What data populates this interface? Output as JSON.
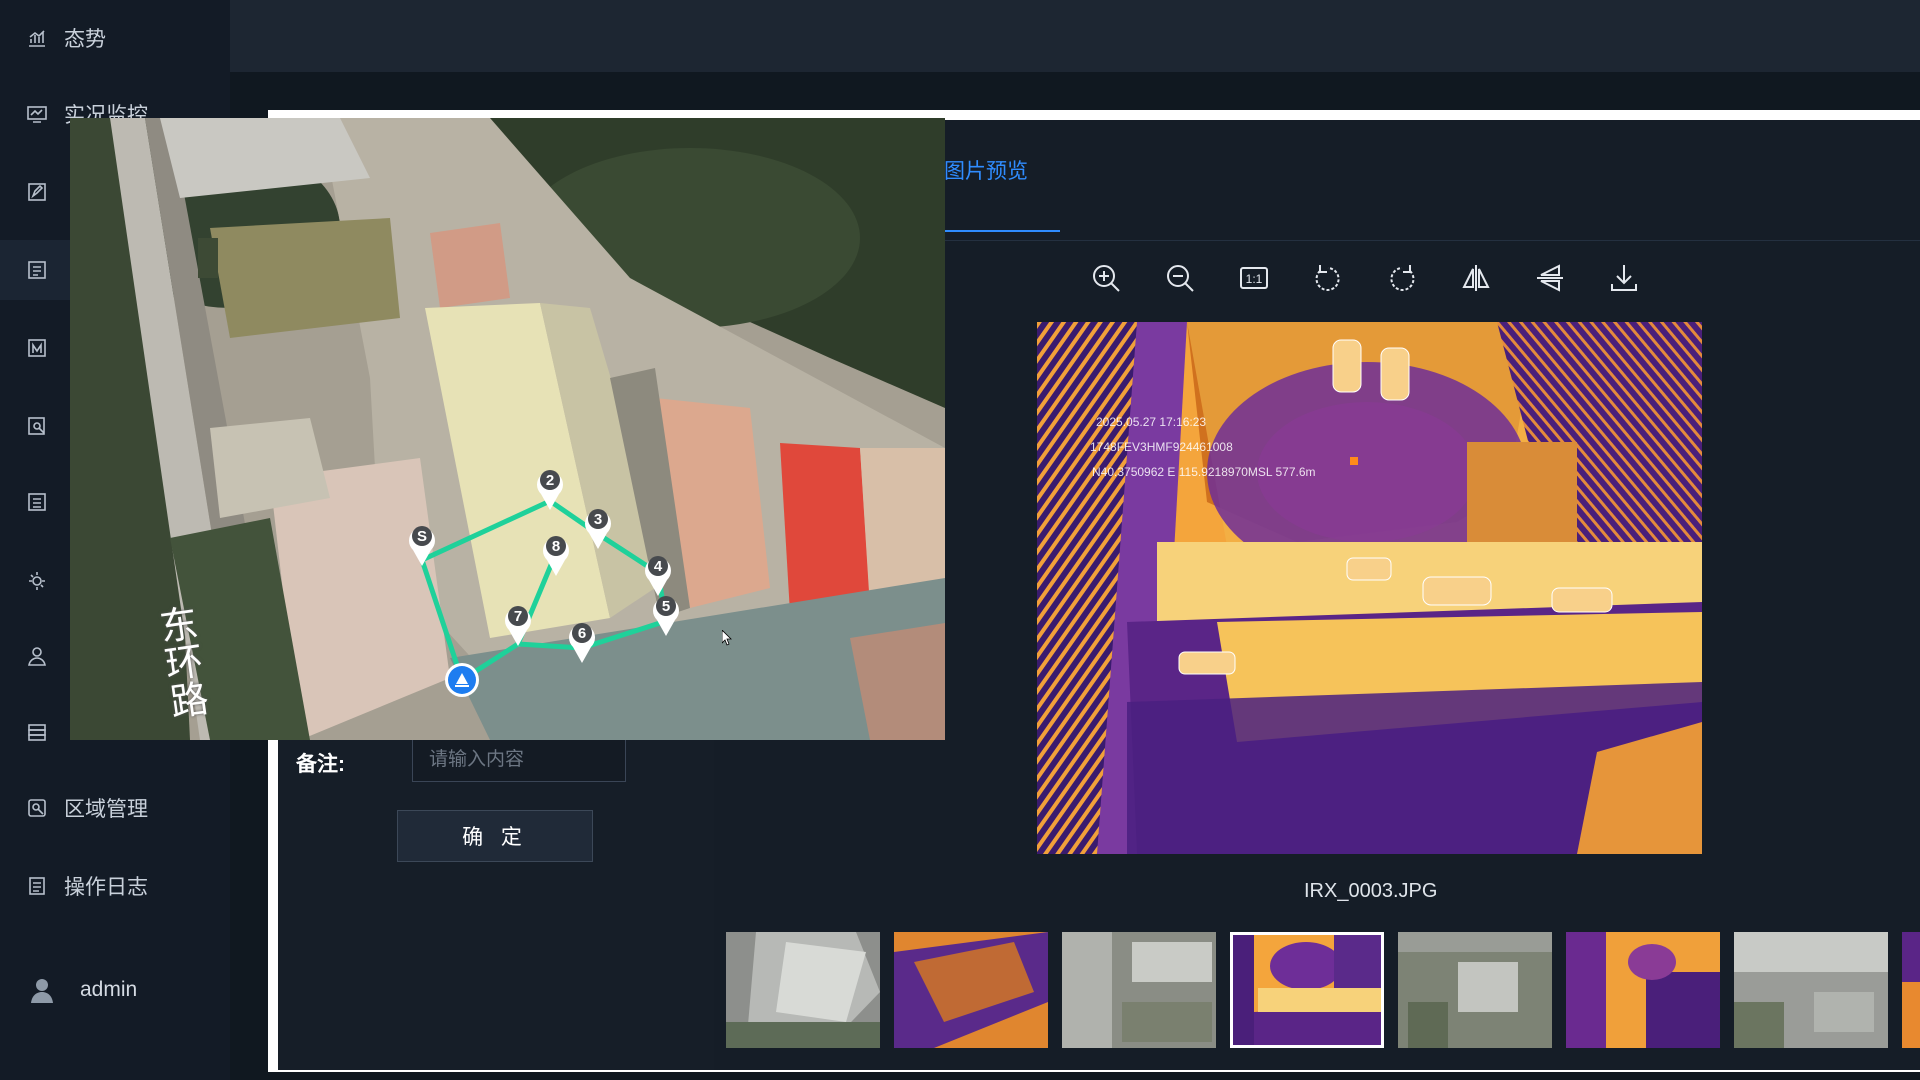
{
  "sidebar": {
    "items": [
      {
        "label": "态势",
        "icon": "chart-icon"
      },
      {
        "label": "实况监控",
        "icon": "monitor-icon"
      },
      {
        "label": "",
        "icon": "edit-icon"
      },
      {
        "label": "",
        "icon": "list-icon"
      },
      {
        "label": "",
        "icon": "route-icon"
      },
      {
        "label": "",
        "icon": "search-doc-icon"
      },
      {
        "label": "",
        "icon": "form-icon"
      },
      {
        "label": "",
        "icon": "settings-icon"
      },
      {
        "label": "",
        "icon": "person-icon"
      },
      {
        "label": "",
        "icon": "server-icon"
      },
      {
        "label": "区域管理",
        "icon": "area-icon"
      },
      {
        "label": "操作日志",
        "icon": "log-icon"
      }
    ],
    "user": {
      "name": "admin",
      "icon": "user-icon"
    }
  },
  "dialog": {
    "tab_label": "图片预览",
    "toolbar": [
      "zoom-in-icon",
      "zoom-out-icon",
      "actual-size-icon",
      "rotate-left-icon",
      "rotate-right-icon",
      "flip-horizontal-icon",
      "flip-vertical-icon",
      "download-icon"
    ],
    "actual_size_label": "1:1",
    "image": {
      "filename": "IRX_0003.JPG",
      "overlay_lines": [
        "2025.05.27 17:16:23",
        "1748FEV3HMF924461008",
        "N40.3750962 E 115.9218970MSL 577.6m"
      ]
    },
    "thumbnails": [
      {
        "kind": "visible",
        "selected": false
      },
      {
        "kind": "thermal",
        "selected": false
      },
      {
        "kind": "visible",
        "selected": false
      },
      {
        "kind": "thermal",
        "selected": true
      },
      {
        "kind": "visible",
        "selected": false
      },
      {
        "kind": "thermal",
        "selected": false
      },
      {
        "kind": "visible",
        "selected": false
      },
      {
        "kind": "thermal",
        "selected": false
      }
    ],
    "form": {
      "remark_label": "备注:",
      "remark_placeholder": "请输入内容",
      "confirm_label": "确 定"
    }
  },
  "map": {
    "road_label": "东环路",
    "waypoints": [
      "S",
      "2",
      "3",
      "4",
      "5",
      "6",
      "7",
      "8"
    ],
    "route_color": "#1fd19a"
  }
}
